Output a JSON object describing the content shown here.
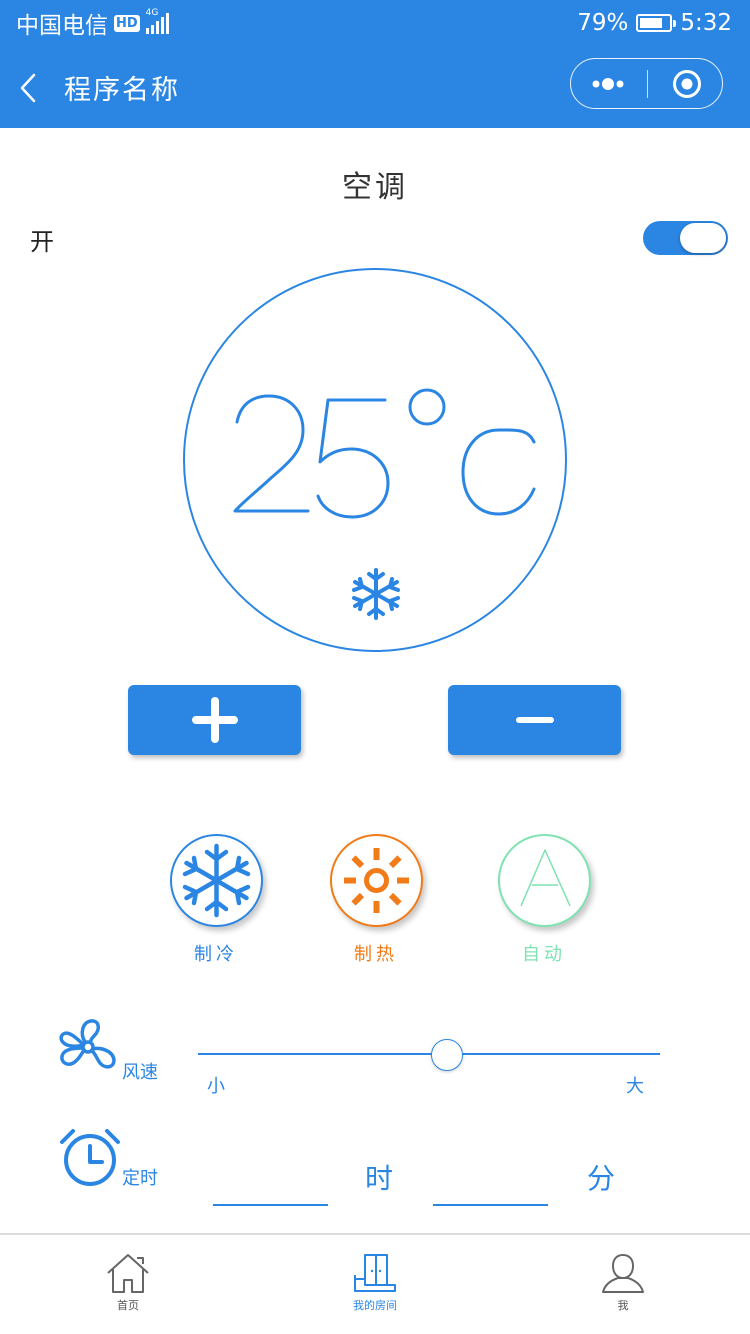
{
  "status_bar": {
    "carrier": "中国电信",
    "hd_badge": "HD",
    "network": "4G",
    "battery_percent": "79%",
    "battery_level": 0.79,
    "time": "5:32"
  },
  "nav": {
    "title": "程序名称"
  },
  "device": {
    "name": "空调",
    "power_label": "开",
    "power_on": true
  },
  "thermostat": {
    "temperature": "25",
    "unit": "°C",
    "mode_icon": "snowflake-icon"
  },
  "modes": [
    {
      "label": "制冷",
      "icon": "snowflake-icon",
      "color": "#2b86e3"
    },
    {
      "label": "制热",
      "icon": "sun-icon",
      "color": "#f07b18"
    },
    {
      "label": "自动",
      "icon": "letter-a-icon",
      "color": "#7fe2b2"
    }
  ],
  "wind": {
    "label": "风速",
    "min_label": "小",
    "max_label": "大",
    "level": 0.54
  },
  "timer": {
    "label": "定时",
    "hour_value": "",
    "minute_value": "",
    "hour_unit": "时",
    "minute_unit": "分"
  },
  "tabbar": {
    "items": [
      {
        "label": "首页",
        "icon": "home-icon"
      },
      {
        "label": "我的房间",
        "icon": "room-icon",
        "active": true
      },
      {
        "label": "我",
        "icon": "person-icon"
      }
    ]
  },
  "colors": {
    "primary": "#2b86e3",
    "heat": "#f07b18",
    "auto": "#7fe2b2"
  }
}
